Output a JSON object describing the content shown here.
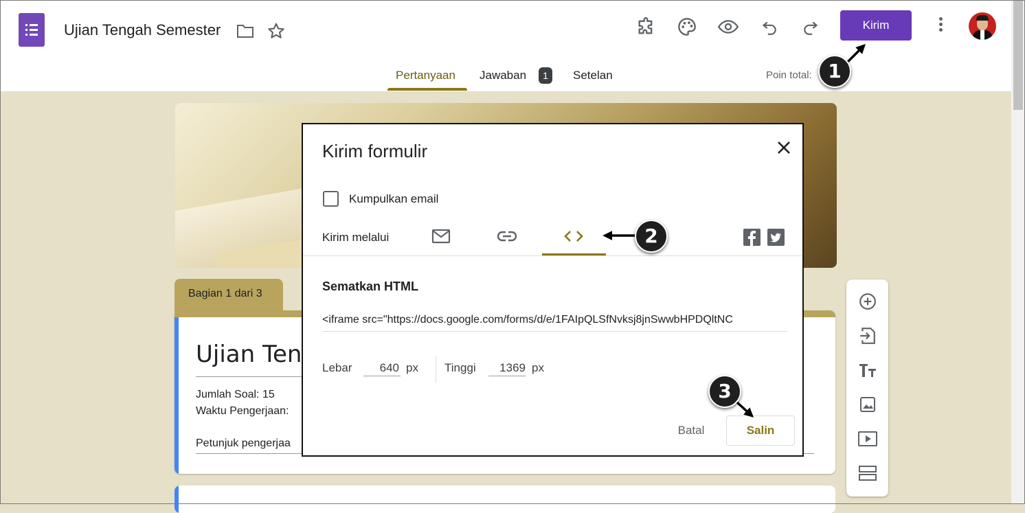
{
  "app": {
    "doc_title": "Ujian Tengah Semester",
    "send_label": "Kirim"
  },
  "tabs": [
    {
      "label": "Pertanyaan",
      "active": true
    },
    {
      "label": "Jawaban",
      "badge": "1"
    },
    {
      "label": "Setelan"
    }
  ],
  "points_label": "Poin total:",
  "form": {
    "section_label": "Bagian 1 dari 3",
    "title": "Ujian Teng",
    "lines": [
      "Jumlah Soal: 15",
      "Waktu Pengerjaan:",
      "Petunjuk pengerjaa"
    ]
  },
  "toolbox": [
    "add-question-icon",
    "import-questions-icon",
    "title-text-icon",
    "image-icon",
    "video-icon",
    "section-icon"
  ],
  "dialog": {
    "title": "Kirim formulir",
    "collect_email": "Kumpulkan email",
    "send_via": "Kirim melalui",
    "embed_heading": "Sematkan HTML",
    "embed_code": "<iframe src=\"https://docs.google.com/forms/d/e/1FAIpQLSfNvksj8jnSwwbHPDQltNC",
    "width_label": "Lebar",
    "width_value": "640",
    "height_label": "Tinggi",
    "height_value": "1369",
    "unit": "px",
    "cancel_label": "Batal",
    "copy_label": "Salin"
  },
  "annotations": [
    "1",
    "2",
    "3"
  ],
  "colors": {
    "accent": "#673ab7",
    "theme_gold": "#8a7716",
    "section_tab": "#b8a45d",
    "canvas_bg": "#e6e0c8"
  }
}
